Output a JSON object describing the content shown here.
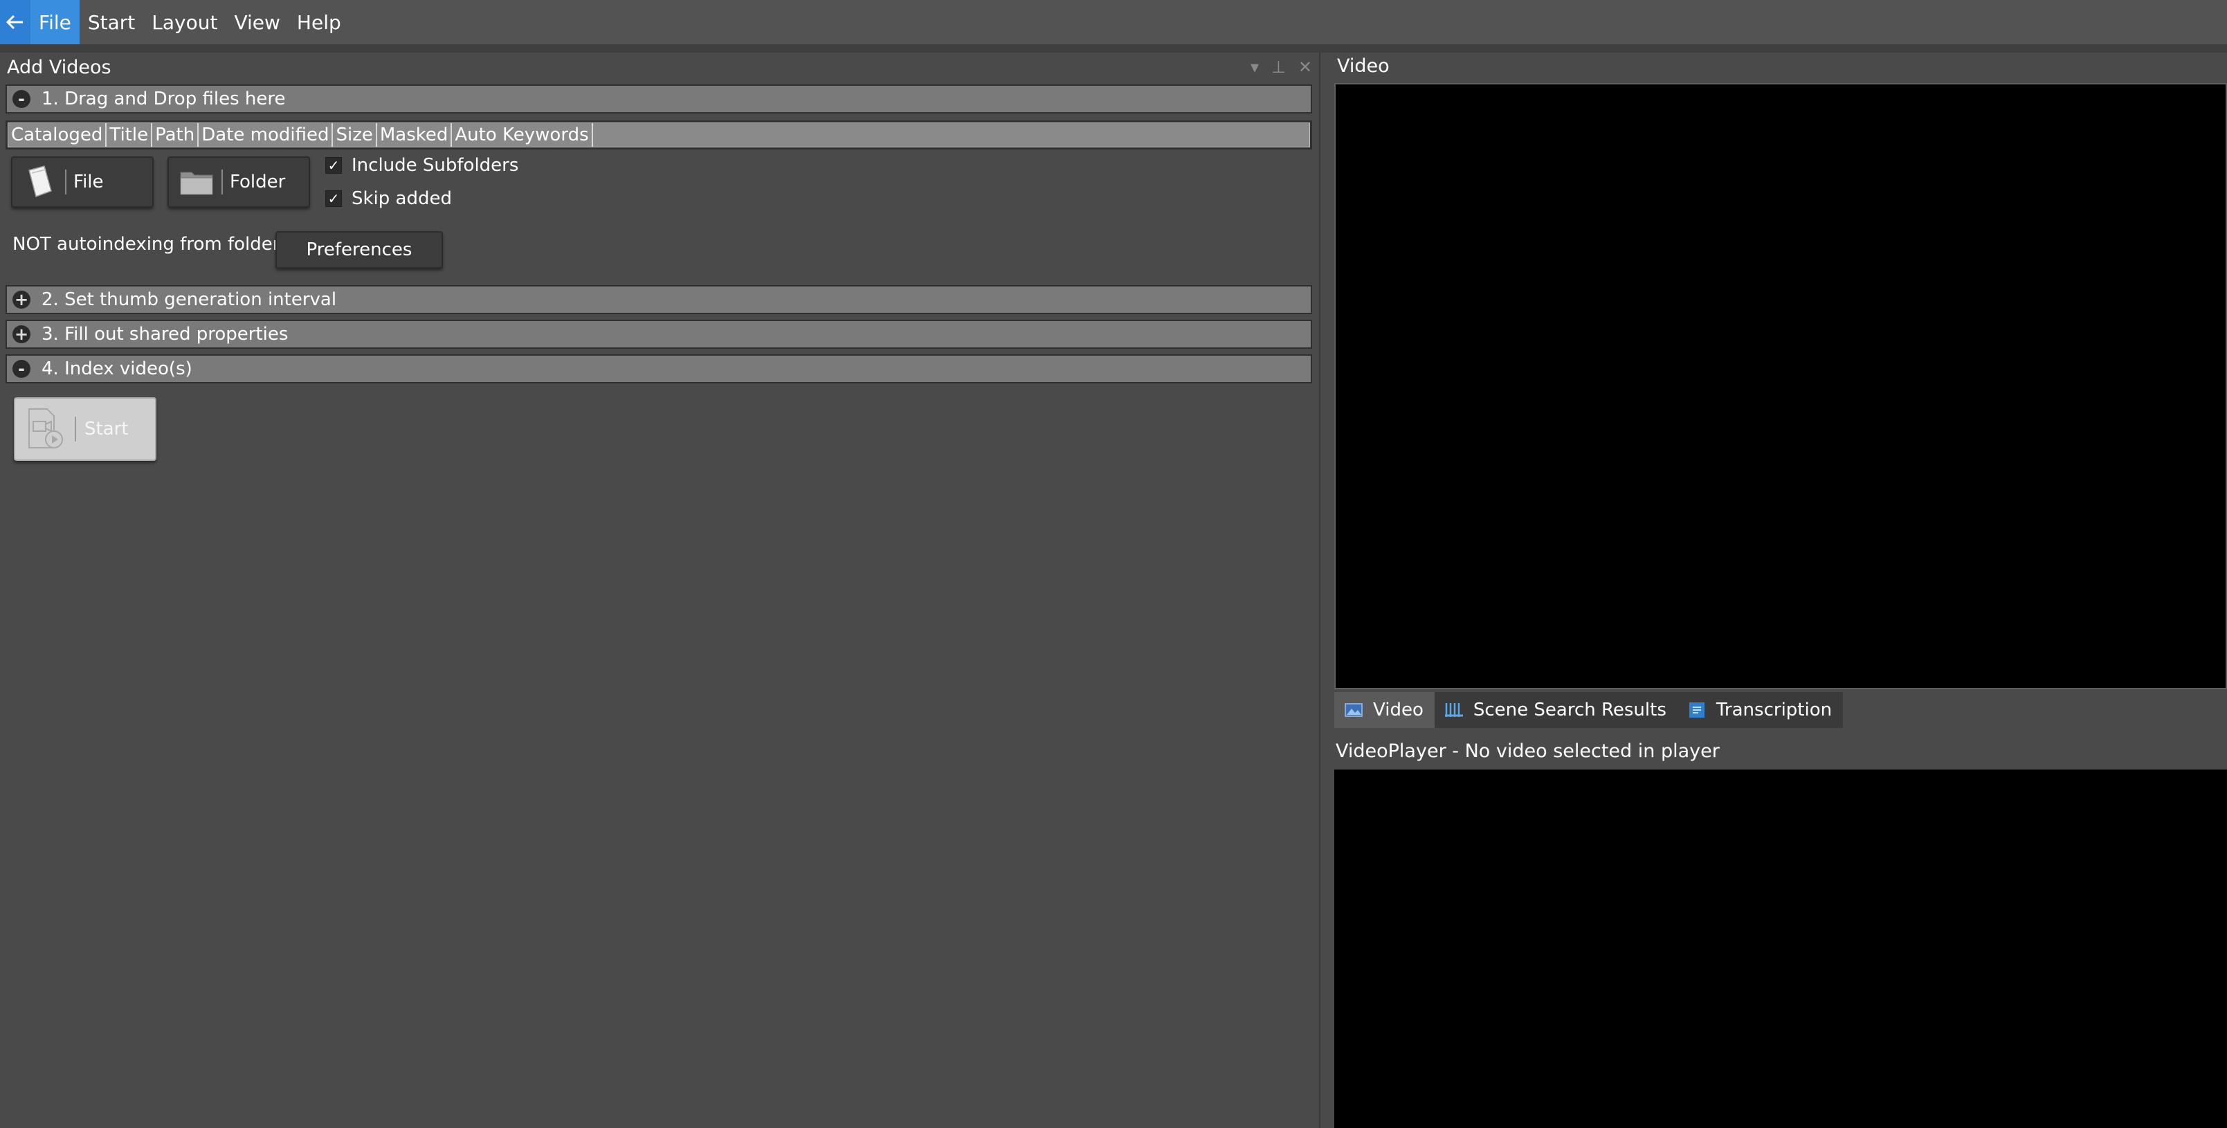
{
  "menu": {
    "items": [
      "File",
      "Start",
      "Layout",
      "View",
      "Help"
    ]
  },
  "left_panel": {
    "title": "Add Videos",
    "sections": [
      {
        "label": "1. Drag and Drop files here",
        "state": "-"
      },
      {
        "label": "2. Set thumb generation interval",
        "state": "+"
      },
      {
        "label": "3. Fill out shared properties",
        "state": "+"
      },
      {
        "label": "4. Index video(s)",
        "state": "-"
      }
    ],
    "columns": [
      "Cataloged",
      "Title",
      "Path",
      "Date modified",
      "Size",
      "Masked",
      "Auto Keywords"
    ],
    "file_button": "File",
    "folder_button": "Folder",
    "include_subfolders": "Include Subfolders",
    "skip_added": "Skip added",
    "autoindex_text": "NOT autoindexing from folder",
    "preferences_button": "Preferences",
    "start_button": "Start"
  },
  "right_panel": {
    "video_title": "Video",
    "tabs": [
      "Video",
      "Scene Search Results",
      "Transcription"
    ],
    "player_title": "VideoPlayer - No video selected in player"
  },
  "colors": {
    "accent": "#3a8ee0",
    "background": "#4a4a4a",
    "section_bar": "#7a7a7a",
    "video_bg": "#000000"
  }
}
